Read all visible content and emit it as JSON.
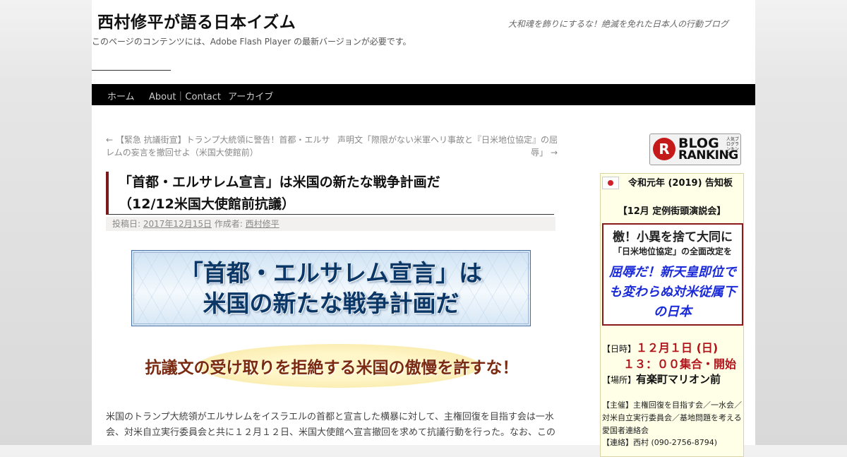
{
  "header": {
    "site_title": "西村修平が語る日本イズム",
    "site_description": "大和魂を飾りにするな！絶滅を免れた日本人の行動ブログ",
    "flash_notice": "このページのコンテンツには、Adobe Flash Player の最新バージョンが必要です。"
  },
  "nav": {
    "items": [
      {
        "label": "ホーム"
      },
      {
        "label": "About｜Contact"
      },
      {
        "label": "アーカイブ"
      }
    ]
  },
  "post_nav": {
    "prev": "← 【緊急 抗議街宣】トランプ大統領に警告！首都・エルサレムの妄言を撤回せよ（米国大使館前）",
    "next": "声明文「際限がない米軍ヘリ事故と『日米地位協定』の屈辱」 →"
  },
  "entry": {
    "title_line1": "「首都・エルサレム宣言」は米国の新たな戦争計画だ",
    "title_line2": "（12/12米国大使館前抗議）",
    "meta_posted_label": "投稿日:",
    "meta_date": "2017年12月15日",
    "meta_author_label": "作成者:",
    "meta_author": "西村修平",
    "banner_line1": "「首都・エルサレム宣言」は",
    "banner_line2": "米国の新たな戦争計画だ",
    "banner2_text": "抗議文の受け取りを拒絶する米国の傲慢を許すな！",
    "body_line1": "米国のトランプ大統領がエルサレムをイスラエルの首都と宣言した横暴に対して、主権回復を目指す会は一水",
    "body_line2": "会、対米自立実行委員会と共に１２月１２日、米国大使館へ宣言撤回を求めて抗議行動を行った。なお、この"
  },
  "sidebar": {
    "ranking_badge": {
      "letter": "R",
      "line1": "BLOG",
      "line2": "RANKING",
      "small": "人気ブログランキング"
    },
    "notice_title": "令和元年 (2019) 告知板",
    "notice_subtitle": "【12月 定例街頭演説会】",
    "box_line1": "檄！小異を捨て大同に",
    "box_line2": "「日米地位協定」の全面改定を",
    "box_line3": "屈辱だ！新天皇即位でも変わらぬ対米従属下の日本",
    "date_label": "【日時】",
    "date_value": "１２月１日 (日)",
    "time_value": "１３：００集合・開始",
    "place_label": "【場所】",
    "place_value": "有楽町マリオン前",
    "host_text": "【主催】主権回復を目指す会／一水会／対米自立実行委員会／基地問題を考える愛国者連絡会",
    "contact_text": "【連絡】西村 (090-2756-8794)"
  }
}
